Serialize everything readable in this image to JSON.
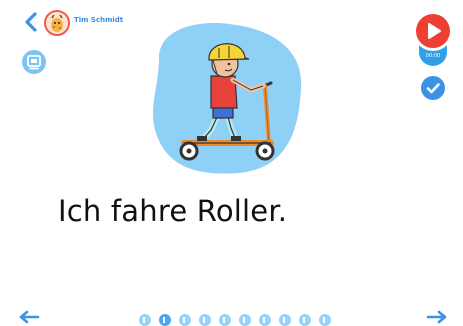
{
  "header": {
    "user_name": "Tim Schmidt",
    "timer": "00:00"
  },
  "page": {
    "sentence": "Ich fahre Roller.",
    "illustration_icon": "boy-on-scooter-illustration"
  },
  "pagination": {
    "total_pages": 10,
    "current_page": 2
  },
  "colors": {
    "accent_blue": "#3a93e5",
    "light_blue": "#8fd0f6",
    "record_red": "#ef3e33"
  }
}
